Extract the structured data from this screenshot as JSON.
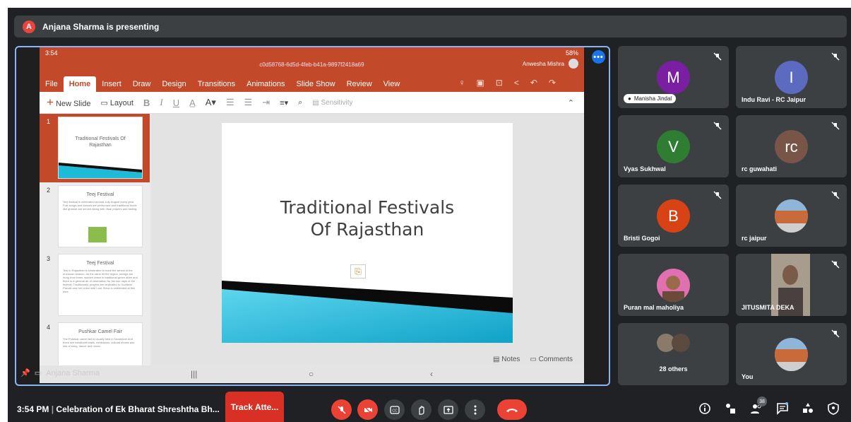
{
  "banner": {
    "avatar_letter": "A",
    "text": "Anjana Sharma is presenting"
  },
  "presentation": {
    "status_left": "3:54",
    "status_right": "58%",
    "file_id": "c0d58768-6d5d-4feb-b41a-9897f2418a69",
    "user": "Anwesha Mishra",
    "tabs": [
      "File",
      "Home",
      "Insert",
      "Draw",
      "Design",
      "Transitions",
      "Animations",
      "Slide Show",
      "Review",
      "View"
    ],
    "ribbon": {
      "new_slide": "New Slide",
      "layout": "Layout",
      "bold": "B",
      "italic": "I",
      "underline": "U",
      "sensitivity": "Sensitivity"
    },
    "thumbnails": [
      {
        "num": "1",
        "title": "Traditional Festivals Of Rajasthan"
      },
      {
        "num": "2",
        "title": "Teej Festival",
        "body": "Teej festival is celebrated around July-August every year. Folk songs and dances are performed and traditional foods like ghewar are served along with ritual prayers and fasting."
      },
      {
        "num": "3",
        "title": "Teej Festival",
        "body": "Teej in Rajasthan is celebrated to mark the arrival of the monsoon season. As the rains hit the region, swings are hung from trees, women dress in traditional green attire and there is a general air of celebration for the two days of the festival. Traditionally, prayers are dedicated to Goddess Parvati and her union with Lord Shiva is celebrated at this time."
      },
      {
        "num": "4",
        "title": "Pushkar Camel Fair",
        "body": "The Pushkar camel fair is usually held in November and there are handicraft stalls, exhibitions, cultural shows and lots of song, dance and music."
      }
    ],
    "slide_title_line1": "Traditional Festivals",
    "slide_title_line2": "Of Rajasthan",
    "notes": "Notes",
    "comments": "Comments",
    "presenter_label": "Anjana Sharma"
  },
  "participants": [
    {
      "name": "Manisha Jindal",
      "initial": "M",
      "color": "#7b1fa2"
    },
    {
      "name": "Indu Ravi - RC Jaipur",
      "initial": "I",
      "color": "#5c6bc0"
    },
    {
      "name": "Vyas Sukhwal",
      "initial": "V",
      "color": "#2e7d32"
    },
    {
      "name": "rc guwahati",
      "initial": "rc",
      "color": "#795548"
    },
    {
      "name": "Bristi Gogoi",
      "initial": "B",
      "color": "#d84315"
    },
    {
      "name": "rc jaipur"
    },
    {
      "name": "Puran mal maholiya"
    },
    {
      "name": "JITUSMITA DEKA"
    },
    {
      "name": "28 others"
    },
    {
      "name": "You"
    }
  ],
  "bottom": {
    "time": "3:54 PM",
    "meeting_title": "Celebration of Ek Bharat Shreshtha Bh...",
    "track": "Track Atte...",
    "people_count": "38"
  }
}
